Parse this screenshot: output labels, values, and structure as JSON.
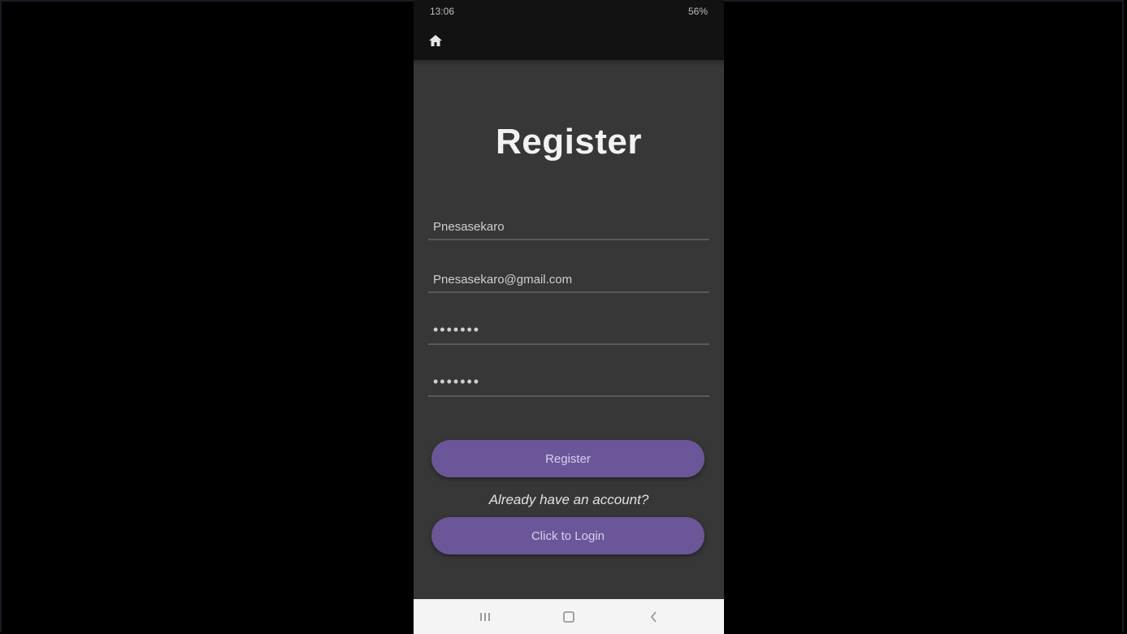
{
  "status_bar": {
    "time": "13:06",
    "indicators": "56%"
  },
  "app_bar": {
    "home_icon": "home-icon"
  },
  "page": {
    "title": "Register"
  },
  "form": {
    "username_value": "Pnesasekaro",
    "email_value": "Pnesasekaro@gmail.com",
    "password_value": "•••••••",
    "confirm_password_value": "•••••••"
  },
  "buttons": {
    "register_label": "Register",
    "login_label": "Click to Login"
  },
  "prompt": {
    "already_have_account": "Already have an account?"
  },
  "nav": {
    "recents_icon": "recents-icon",
    "home_icon": "home-square-icon",
    "back_icon": "back-icon"
  },
  "colors": {
    "background": "#373737",
    "button": "#6a5699",
    "status_bar": "#121212",
    "nav_bar": "#f4f4f4"
  }
}
